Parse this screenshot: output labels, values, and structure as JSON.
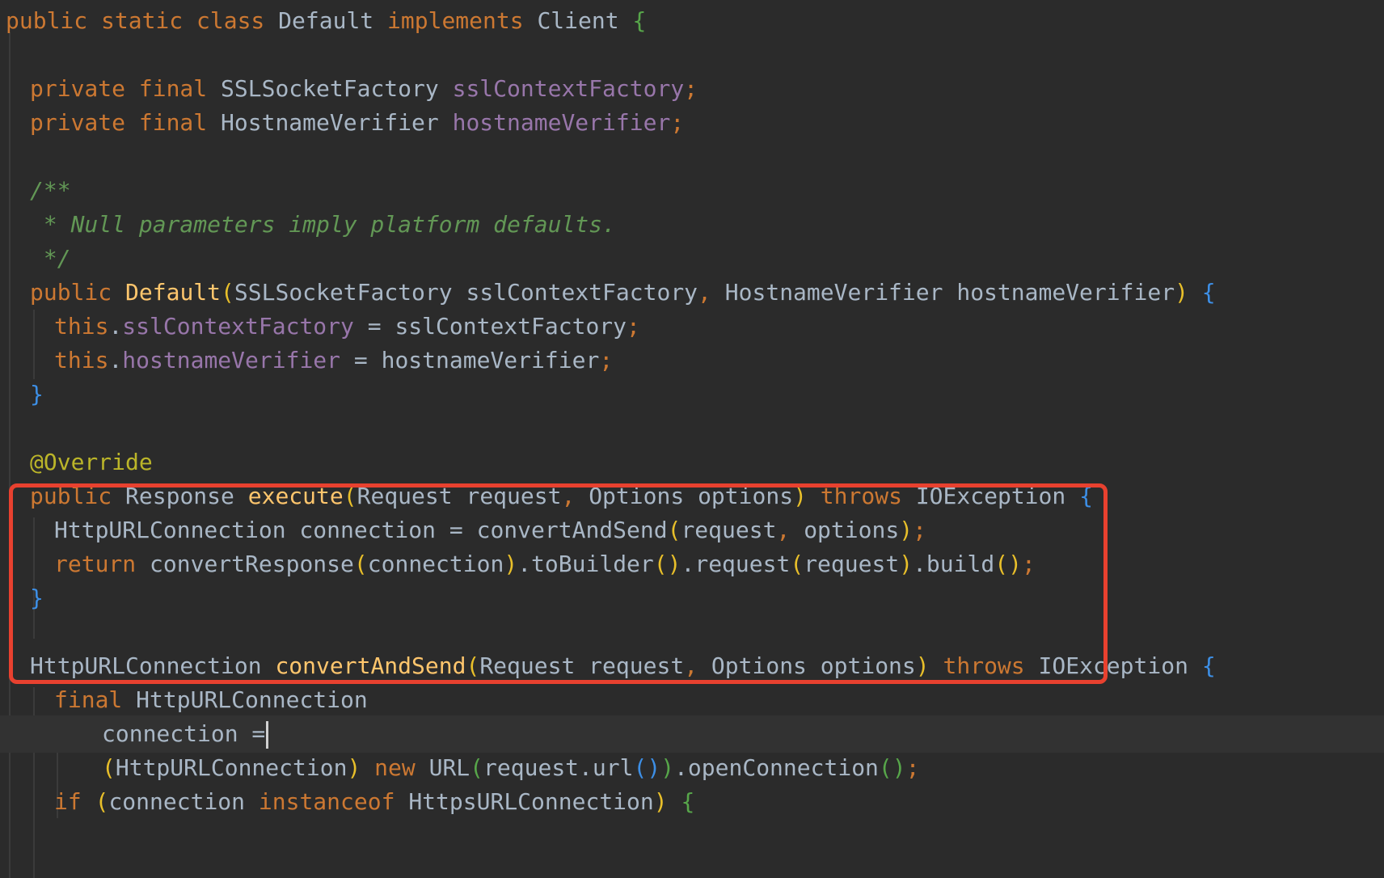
{
  "editor": {
    "colors": {
      "background": "#2b2b2b",
      "keyword": "#cc7832",
      "field": "#9876aa",
      "method": "#ffc66d",
      "annotation": "#bbb529",
      "comment": "#629755",
      "default": "#a9b7c6",
      "highlight_box": "#e8412f"
    },
    "lines": [
      {
        "tokens": [
          {
            "t": "public static class ",
            "c": "kw"
          },
          {
            "t": "Default ",
            "c": "type"
          },
          {
            "t": "implements ",
            "c": "kw"
          },
          {
            "t": "Client ",
            "c": "type"
          },
          {
            "t": "{",
            "c": "brace-green"
          }
        ]
      },
      {
        "tokens": []
      },
      {
        "tokens": [
          {
            "t": "private final ",
            "c": "kw"
          },
          {
            "t": "SSLSocketFactory ",
            "c": "type"
          },
          {
            "t": "sslContextFactory",
            "c": "field"
          },
          {
            "t": ";",
            "c": "semi"
          }
        ]
      },
      {
        "tokens": [
          {
            "t": "private final ",
            "c": "kw"
          },
          {
            "t": "HostnameVerifier ",
            "c": "type"
          },
          {
            "t": "hostnameVerifier",
            "c": "field"
          },
          {
            "t": ";",
            "c": "semi"
          }
        ]
      },
      {
        "tokens": []
      },
      {
        "tokens": [
          {
            "t": "/**",
            "c": "comment"
          }
        ]
      },
      {
        "tokens": [
          {
            "t": " * Null parameters imply platform defaults.",
            "c": "comment"
          }
        ]
      },
      {
        "tokens": [
          {
            "t": " */",
            "c": "comment"
          }
        ]
      },
      {
        "tokens": [
          {
            "t": "public ",
            "c": "kw"
          },
          {
            "t": "Default",
            "c": "method"
          },
          {
            "t": "(",
            "c": "paren-yellow"
          },
          {
            "t": "SSLSocketFactory sslContextFactory",
            "c": "ident"
          },
          {
            "t": ", ",
            "c": "semi"
          },
          {
            "t": "HostnameVerifier hostnameVerifier",
            "c": "ident"
          },
          {
            "t": ") ",
            "c": "paren-yellow"
          },
          {
            "t": "{",
            "c": "brace-blue"
          }
        ]
      },
      {
        "tokens": [
          {
            "t": "this",
            "c": "kw"
          },
          {
            "t": ".",
            "c": "punct"
          },
          {
            "t": "sslContextFactory",
            "c": "field"
          },
          {
            "t": " = sslContextFactory",
            "c": "ident"
          },
          {
            "t": ";",
            "c": "semi"
          }
        ]
      },
      {
        "tokens": [
          {
            "t": "this",
            "c": "kw"
          },
          {
            "t": ".",
            "c": "punct"
          },
          {
            "t": "hostnameVerifier",
            "c": "field"
          },
          {
            "t": " = hostnameVerifier",
            "c": "ident"
          },
          {
            "t": ";",
            "c": "semi"
          }
        ]
      },
      {
        "tokens": [
          {
            "t": "}",
            "c": "brace-blue"
          }
        ]
      },
      {
        "tokens": []
      },
      {
        "tokens": [
          {
            "t": "@Override",
            "c": "ann"
          }
        ]
      },
      {
        "tokens": [
          {
            "t": "public ",
            "c": "kw"
          },
          {
            "t": "Response ",
            "c": "type"
          },
          {
            "t": "execute",
            "c": "method"
          },
          {
            "t": "(",
            "c": "paren-yellow"
          },
          {
            "t": "Request request",
            "c": "ident"
          },
          {
            "t": ", ",
            "c": "semi"
          },
          {
            "t": "Options options",
            "c": "ident"
          },
          {
            "t": ") ",
            "c": "paren-yellow"
          },
          {
            "t": "throws ",
            "c": "kw"
          },
          {
            "t": "IOException ",
            "c": "type"
          },
          {
            "t": "{",
            "c": "brace-blue"
          }
        ]
      },
      {
        "tokens": [
          {
            "t": "HttpURLConnection connection = convertAndSend",
            "c": "ident"
          },
          {
            "t": "(",
            "c": "paren-yellow"
          },
          {
            "t": "request",
            "c": "ident"
          },
          {
            "t": ", ",
            "c": "semi"
          },
          {
            "t": "options",
            "c": "ident"
          },
          {
            "t": ")",
            "c": "paren-yellow"
          },
          {
            "t": ";",
            "c": "semi"
          }
        ]
      },
      {
        "tokens": [
          {
            "t": "return ",
            "c": "kw"
          },
          {
            "t": "convertResponse",
            "c": "ident"
          },
          {
            "t": "(",
            "c": "paren-yellow"
          },
          {
            "t": "connection",
            "c": "ident"
          },
          {
            "t": ")",
            "c": "paren-yellow"
          },
          {
            "t": ".toBuilder",
            "c": "ident"
          },
          {
            "t": "()",
            "c": "paren-yellow"
          },
          {
            "t": ".request",
            "c": "ident"
          },
          {
            "t": "(",
            "c": "paren-yellow"
          },
          {
            "t": "request",
            "c": "ident"
          },
          {
            "t": ")",
            "c": "paren-yellow"
          },
          {
            "t": ".build",
            "c": "ident"
          },
          {
            "t": "()",
            "c": "paren-yellow"
          },
          {
            "t": ";",
            "c": "semi"
          }
        ]
      },
      {
        "tokens": [
          {
            "t": "}",
            "c": "brace-blue"
          }
        ]
      },
      {
        "tokens": []
      },
      {
        "tokens": [
          {
            "t": "HttpURLConnection ",
            "c": "type"
          },
          {
            "t": "convertAndSend",
            "c": "method"
          },
          {
            "t": "(",
            "c": "paren-yellow"
          },
          {
            "t": "Request request",
            "c": "ident"
          },
          {
            "t": ", ",
            "c": "semi"
          },
          {
            "t": "Options options",
            "c": "ident"
          },
          {
            "t": ") ",
            "c": "paren-yellow"
          },
          {
            "t": "throws ",
            "c": "kw"
          },
          {
            "t": "IOException ",
            "c": "type"
          },
          {
            "t": "{",
            "c": "brace-blue"
          }
        ]
      },
      {
        "tokens": [
          {
            "t": "final ",
            "c": "kw"
          },
          {
            "t": "HttpURLConnection",
            "c": "type"
          }
        ]
      },
      {
        "tokens": [
          {
            "t": "connection =",
            "c": "ident"
          }
        ],
        "caret": true
      },
      {
        "tokens": [
          {
            "t": "(",
            "c": "paren-yellow"
          },
          {
            "t": "HttpURLConnection",
            "c": "type"
          },
          {
            "t": ") ",
            "c": "paren-yellow"
          },
          {
            "t": "new ",
            "c": "kw"
          },
          {
            "t": "URL",
            "c": "type"
          },
          {
            "t": "(",
            "c": "paren-green"
          },
          {
            "t": "request.url",
            "c": "ident"
          },
          {
            "t": "()",
            "c": "paren-blue"
          },
          {
            "t": ")",
            "c": "paren-green"
          },
          {
            "t": ".openConnection",
            "c": "ident"
          },
          {
            "t": "()",
            "c": "paren-green"
          },
          {
            "t": ";",
            "c": "semi"
          }
        ]
      },
      {
        "tokens": [
          {
            "t": "if ",
            "c": "kw"
          },
          {
            "t": "(",
            "c": "paren-yellow"
          },
          {
            "t": "connection ",
            "c": "ident"
          },
          {
            "t": "instanceof ",
            "c": "kw"
          },
          {
            "t": "HttpsURLConnection",
            "c": "type"
          },
          {
            "t": ") ",
            "c": "paren-yellow"
          },
          {
            "t": "{",
            "c": "brace-green"
          }
        ]
      }
    ]
  }
}
